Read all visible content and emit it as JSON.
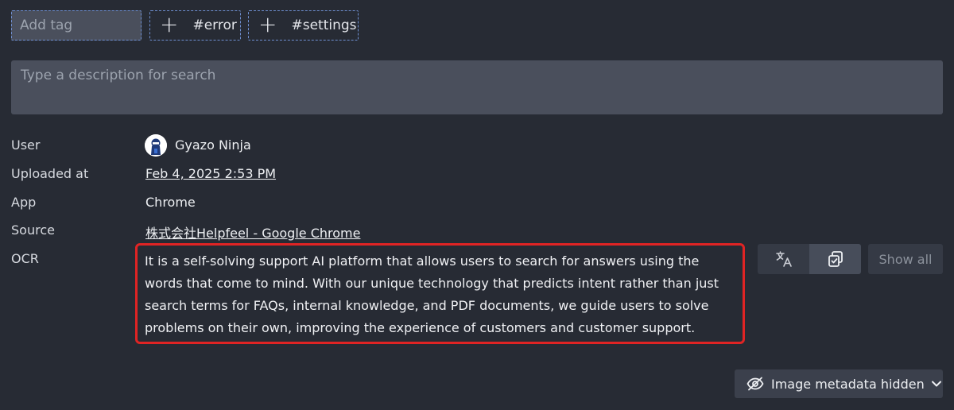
{
  "tags": {
    "input_placeholder": "Add tag",
    "items": [
      {
        "label": "#error"
      },
      {
        "label": "#settings"
      }
    ]
  },
  "description": {
    "placeholder": "Type a description for search"
  },
  "metadata": {
    "user_label": "User",
    "user_name": "Gyazo Ninja",
    "uploaded_label": "Uploaded at",
    "uploaded_value": "Feb 4, 2025 2:53 PM",
    "app_label": "App",
    "app_value": "Chrome",
    "source_label": "Source",
    "source_value": "株式会社Helpfeel - Google Chrome",
    "ocr_label": "OCR",
    "ocr_text": "It is a self-solving support AI platform that allows users to search for answers using the words that come to mind. With our unique technology that predicts intent rather than just search terms for FAQs, internal knowledge, and PDF documents, we guide users to solve problems on their own, improving the experience of customers and customer support."
  },
  "ocr_actions": {
    "translate_icon": "translate-icon",
    "copy_icon": "copy-icon",
    "show_all_label": "Show all"
  },
  "footer": {
    "metadata_toggle_label": "Image metadata hidden",
    "eye_icon": "eye-slash-icon",
    "chevron_icon": "chevron-down-icon"
  },
  "colors": {
    "background": "#272b34",
    "field": "#4a4f5c",
    "tag_border": "#6f8fd0",
    "ocr_highlight": "#e02424"
  }
}
